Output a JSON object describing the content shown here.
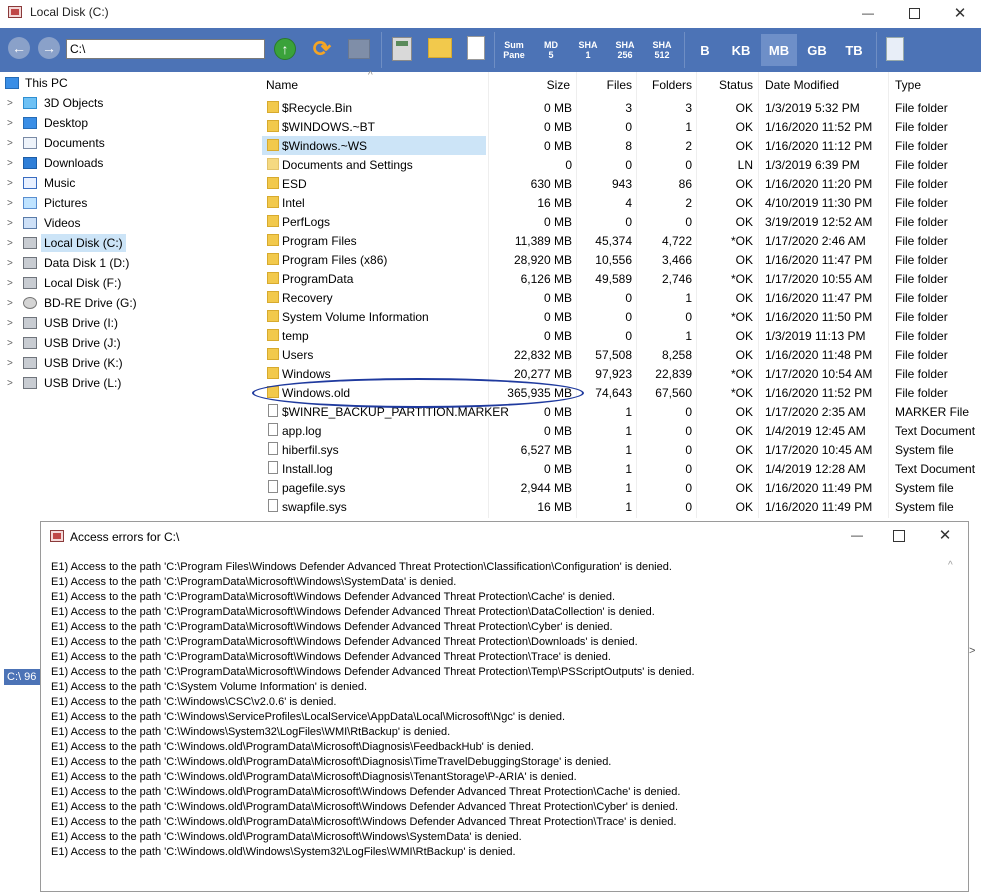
{
  "window": {
    "title": "Local Disk (C:)"
  },
  "toolbar": {
    "path": "C:\\",
    "sum_pane": [
      "Sum",
      "Pane"
    ],
    "md5": [
      "MD",
      "5"
    ],
    "sha1": [
      "SHA",
      "1"
    ],
    "sha256": [
      "SHA",
      "256"
    ],
    "sha512": [
      "SHA",
      "512"
    ],
    "units": [
      "B",
      "KB",
      "MB",
      "GB",
      "TB"
    ],
    "active_unit": "MB"
  },
  "tree": [
    {
      "label": "This PC",
      "icon": "pc-icon",
      "level": 0
    },
    {
      "label": "3D Objects",
      "icon": "3d-objects-icon",
      "level": 1
    },
    {
      "label": "Desktop",
      "icon": "desktop-icon",
      "level": 1
    },
    {
      "label": "Documents",
      "icon": "documents-icon",
      "level": 1
    },
    {
      "label": "Downloads",
      "icon": "downloads-icon",
      "level": 1
    },
    {
      "label": "Music",
      "icon": "music-icon",
      "level": 1
    },
    {
      "label": "Pictures",
      "icon": "pictures-icon",
      "level": 1
    },
    {
      "label": "Videos",
      "icon": "videos-icon",
      "level": 1
    },
    {
      "label": "Local Disk (C:)",
      "icon": "drive-icon",
      "level": 1,
      "selected": true
    },
    {
      "label": "Data Disk 1 (D:)",
      "icon": "drive-icon",
      "level": 1
    },
    {
      "label": "Local Disk (F:)",
      "icon": "drive-icon",
      "level": 1
    },
    {
      "label": "BD-RE Drive (G:)",
      "icon": "optical-drive-icon",
      "level": 1
    },
    {
      "label": "USB Drive (I:)",
      "icon": "usb-drive-icon",
      "level": 1
    },
    {
      "label": "USB Drive (J:)",
      "icon": "usb-drive-icon",
      "level": 1
    },
    {
      "label": "USB Drive (K:)",
      "icon": "usb-drive-icon",
      "level": 1
    },
    {
      "label": "USB Drive (L:)",
      "icon": "usb-drive-icon",
      "level": 1
    }
  ],
  "columns": [
    "Name",
    "Size",
    "Files",
    "Folders",
    "Status",
    "Date Modified",
    "Type"
  ],
  "rows": [
    {
      "name": "$Recycle.Bin",
      "size": "0 MB",
      "files": "3",
      "folders": "3",
      "status": "OK",
      "date": "1/3/2019 5:32 PM",
      "type": "File folder",
      "icon": "folder"
    },
    {
      "name": "$WINDOWS.~BT",
      "size": "0 MB",
      "files": "0",
      "folders": "1",
      "status": "OK",
      "date": "1/16/2020 11:52 PM",
      "type": "File folder",
      "icon": "folder"
    },
    {
      "name": "$Windows.~WS",
      "size": "0 MB",
      "files": "8",
      "folders": "2",
      "status": "OK",
      "date": "1/16/2020 11:12 PM",
      "type": "File folder",
      "icon": "folder",
      "highlight": true
    },
    {
      "name": "Documents and Settings",
      "size": "0",
      "files": "0",
      "folders": "0",
      "status": "LN",
      "date": "1/3/2019 6:39 PM",
      "type": "File folder",
      "icon": "link"
    },
    {
      "name": "ESD",
      "size": "630 MB",
      "files": "943",
      "folders": "86",
      "status": "OK",
      "date": "1/16/2020 11:20 PM",
      "type": "File folder",
      "icon": "folder"
    },
    {
      "name": "Intel",
      "size": "16 MB",
      "files": "4",
      "folders": "2",
      "status": "OK",
      "date": "4/10/2019 11:30 PM",
      "type": "File folder",
      "icon": "folder"
    },
    {
      "name": "PerfLogs",
      "size": "0 MB",
      "files": "0",
      "folders": "0",
      "status": "OK",
      "date": "3/19/2019 12:52 AM",
      "type": "File folder",
      "icon": "folder"
    },
    {
      "name": "Program Files",
      "size": "11,389 MB",
      "files": "45,374",
      "folders": "4,722",
      "status": "*OK",
      "date": "1/17/2020 2:46 AM",
      "type": "File folder",
      "icon": "folder"
    },
    {
      "name": "Program Files (x86)",
      "size": "28,920 MB",
      "files": "10,556",
      "folders": "3,466",
      "status": "OK",
      "date": "1/16/2020 11:47 PM",
      "type": "File folder",
      "icon": "folder"
    },
    {
      "name": "ProgramData",
      "size": "6,126 MB",
      "files": "49,589",
      "folders": "2,746",
      "status": "*OK",
      "date": "1/17/2020 10:55 AM",
      "type": "File folder",
      "icon": "folder"
    },
    {
      "name": "Recovery",
      "size": "0 MB",
      "files": "0",
      "folders": "1",
      "status": "OK",
      "date": "1/16/2020 11:47 PM",
      "type": "File folder",
      "icon": "folder"
    },
    {
      "name": "System Volume Information",
      "size": "0 MB",
      "files": "0",
      "folders": "0",
      "status": "*OK",
      "date": "1/16/2020 11:50 PM",
      "type": "File folder",
      "icon": "folder"
    },
    {
      "name": "temp",
      "size": "0 MB",
      "files": "0",
      "folders": "1",
      "status": "OK",
      "date": "1/3/2019 11:13 PM",
      "type": "File folder",
      "icon": "folder"
    },
    {
      "name": "Users",
      "size": "22,832 MB",
      "files": "57,508",
      "folders": "8,258",
      "status": "OK",
      "date": "1/16/2020 11:48 PM",
      "type": "File folder",
      "icon": "folder"
    },
    {
      "name": "Windows",
      "size": "20,277 MB",
      "files": "97,923",
      "folders": "22,839",
      "status": "*OK",
      "date": "1/17/2020 10:54 AM",
      "type": "File folder",
      "icon": "folder"
    },
    {
      "name": "Windows.old",
      "size": "365,935 MB",
      "files": "74,643",
      "folders": "67,560",
      "status": "*OK",
      "date": "1/16/2020 11:52 PM",
      "type": "File folder",
      "icon": "folder"
    },
    {
      "name": "$WINRE_BACKUP_PARTITION.MARKER",
      "size": "0 MB",
      "files": "1",
      "folders": "0",
      "status": "OK",
      "date": "1/17/2020 2:35 AM",
      "type": "MARKER File",
      "icon": "file"
    },
    {
      "name": "app.log",
      "size": "0 MB",
      "files": "1",
      "folders": "0",
      "status": "OK",
      "date": "1/4/2019 12:45 AM",
      "type": "Text Document",
      "icon": "file"
    },
    {
      "name": "hiberfil.sys",
      "size": "6,527 MB",
      "files": "1",
      "folders": "0",
      "status": "OK",
      "date": "1/17/2020 10:45 AM",
      "type": "System file",
      "icon": "file"
    },
    {
      "name": "Install.log",
      "size": "0 MB",
      "files": "1",
      "folders": "0",
      "status": "OK",
      "date": "1/4/2019 12:28 AM",
      "type": "Text Document",
      "icon": "file"
    },
    {
      "name": "pagefile.sys",
      "size": "2,944 MB",
      "files": "1",
      "folders": "0",
      "status": "OK",
      "date": "1/16/2020 11:49 PM",
      "type": "System file",
      "icon": "file"
    },
    {
      "name": "swapfile.sys",
      "size": "16 MB",
      "files": "1",
      "folders": "0",
      "status": "OK",
      "date": "1/16/2020 11:49 PM",
      "type": "System file",
      "icon": "file"
    }
  ],
  "status_bar": {
    "text": "C:\\ 96"
  },
  "dialog": {
    "title": "Access errors for C:\\",
    "lines": [
      "E1) Access to the path 'C:\\Program Files\\Windows Defender Advanced Threat Protection\\Classification\\Configuration' is denied.",
      "E1) Access to the path 'C:\\ProgramData\\Microsoft\\Windows\\SystemData' is denied.",
      "E1) Access to the path 'C:\\ProgramData\\Microsoft\\Windows Defender Advanced Threat Protection\\Cache' is denied.",
      "E1) Access to the path 'C:\\ProgramData\\Microsoft\\Windows Defender Advanced Threat Protection\\DataCollection' is denied.",
      "E1) Access to the path 'C:\\ProgramData\\Microsoft\\Windows Defender Advanced Threat Protection\\Cyber' is denied.",
      "E1) Access to the path 'C:\\ProgramData\\Microsoft\\Windows Defender Advanced Threat Protection\\Downloads' is denied.",
      "E1) Access to the path 'C:\\ProgramData\\Microsoft\\Windows Defender Advanced Threat Protection\\Trace' is denied.",
      "E1) Access to the path 'C:\\ProgramData\\Microsoft\\Windows Defender Advanced Threat Protection\\Temp\\PSScriptOutputs' is denied.",
      "E1) Access to the path 'C:\\System Volume Information' is denied.",
      "E1) Access to the path 'C:\\Windows\\CSC\\v2.0.6' is denied.",
      "E1) Access to the path 'C:\\Windows\\ServiceProfiles\\LocalService\\AppData\\Local\\Microsoft\\Ngc' is denied.",
      "E1) Access to the path 'C:\\Windows\\System32\\LogFiles\\WMI\\RtBackup' is denied.",
      "E1) Access to the path 'C:\\Windows.old\\ProgramData\\Microsoft\\Diagnosis\\FeedbackHub' is denied.",
      "E1) Access to the path 'C:\\Windows.old\\ProgramData\\Microsoft\\Diagnosis\\TimeTravelDebuggingStorage' is denied.",
      "E1) Access to the path 'C:\\Windows.old\\ProgramData\\Microsoft\\Diagnosis\\TenantStorage\\P-ARIA' is denied.",
      "E1) Access to the path 'C:\\Windows.old\\ProgramData\\Microsoft\\Windows Defender Advanced Threat Protection\\Cache' is denied.",
      "E1) Access to the path 'C:\\Windows.old\\ProgramData\\Microsoft\\Windows Defender Advanced Threat Protection\\Cyber' is denied.",
      "E1) Access to the path 'C:\\Windows.old\\ProgramData\\Microsoft\\Windows Defender Advanced Threat Protection\\Trace' is denied.",
      "E1) Access to the path 'C:\\Windows.old\\ProgramData\\Microsoft\\Windows\\SystemData' is denied.",
      "E1) Access to the path 'C:\\Windows.old\\Windows\\System32\\LogFiles\\WMI\\RtBackup' is denied."
    ]
  },
  "colors": {
    "toolbar": "#4c73b6",
    "selection": "#cce4f7",
    "annotation": "#1f3a9e"
  }
}
